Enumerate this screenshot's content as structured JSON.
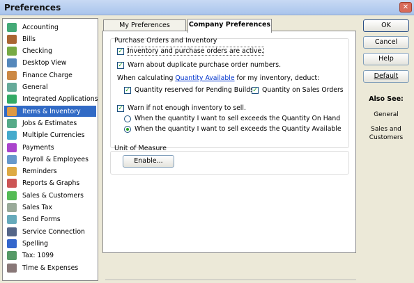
{
  "window": {
    "title": "Preferences",
    "close_glyph": "✕"
  },
  "sidebar": {
    "items": [
      {
        "label": "Accounting",
        "icon": "accounting-icon"
      },
      {
        "label": "Bills",
        "icon": "bills-icon"
      },
      {
        "label": "Checking",
        "icon": "checking-icon"
      },
      {
        "label": "Desktop View",
        "icon": "desktop-view-icon"
      },
      {
        "label": "Finance Charge",
        "icon": "finance-charge-icon"
      },
      {
        "label": "General",
        "icon": "general-icon"
      },
      {
        "label": "Integrated Applications",
        "icon": "integrated-applications-icon"
      },
      {
        "label": "Items & Inventory",
        "icon": "items-inventory-icon",
        "selected": true
      },
      {
        "label": "Jobs & Estimates",
        "icon": "jobs-estimates-icon"
      },
      {
        "label": "Multiple Currencies",
        "icon": "multiple-currencies-icon"
      },
      {
        "label": "Payments",
        "icon": "payments-icon"
      },
      {
        "label": "Payroll & Employees",
        "icon": "payroll-employees-icon"
      },
      {
        "label": "Reminders",
        "icon": "reminders-icon"
      },
      {
        "label": "Reports & Graphs",
        "icon": "reports-graphs-icon"
      },
      {
        "label": "Sales & Customers",
        "icon": "sales-customers-icon"
      },
      {
        "label": "Sales Tax",
        "icon": "sales-tax-icon"
      },
      {
        "label": "Send Forms",
        "icon": "send-forms-icon"
      },
      {
        "label": "Service Connection",
        "icon": "service-connection-icon"
      },
      {
        "label": "Spelling",
        "icon": "spelling-icon"
      },
      {
        "label": "Tax: 1099",
        "icon": "tax-1099-icon"
      },
      {
        "label": "Time & Expenses",
        "icon": "time-expenses-icon"
      }
    ]
  },
  "tabs": {
    "my_preferences": "My Preferences",
    "company_preferences": "Company Preferences"
  },
  "purchase_orders": {
    "group_title": "Purchase Orders and Inventory",
    "inventory_active": {
      "label": "Inventory and purchase orders are active.",
      "checked": true
    },
    "warn_duplicate": {
      "label": "Warn about duplicate purchase order numbers.",
      "checked": true
    },
    "calc_prefix": "When calculating ",
    "calc_link": "Quantity Available",
    "calc_suffix": " for my inventory, deduct:",
    "pending_builds": {
      "label": "Quantity reserved for Pending Builds",
      "checked": true
    },
    "sales_orders": {
      "label": "Quantity on Sales Orders",
      "checked": true
    },
    "warn_not_enough": {
      "label": "Warn if not enough inventory to sell.",
      "checked": true
    },
    "radio_on_hand": {
      "label": "When the quantity I want to sell exceeds the Quantity On Hand",
      "selected": false
    },
    "radio_available": {
      "label": "When the quantity I want to sell exceeds the Quantity Available",
      "selected": true
    }
  },
  "unit_of_measure": {
    "group_title": "Unit of Measure",
    "enable_label": "Enable..."
  },
  "buttons": {
    "ok": "OK",
    "cancel": "Cancel",
    "help": "Help",
    "default": "Default"
  },
  "also_see": {
    "title": "Also See:",
    "links": [
      "General",
      "Sales and Customers"
    ]
  },
  "colors": {
    "selection": "#316ac5",
    "link": "#0033cc",
    "check": "#21a121",
    "dialog_bg": "#ece9d8"
  }
}
